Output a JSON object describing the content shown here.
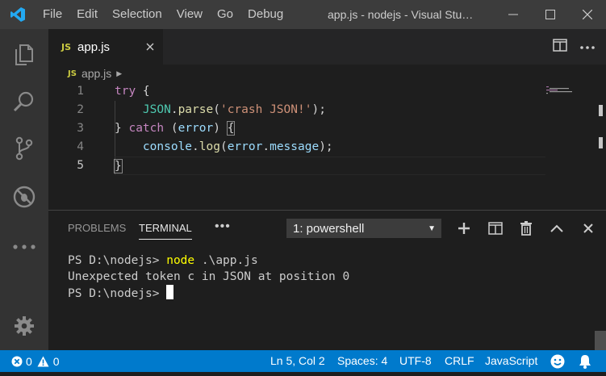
{
  "titlebar": {
    "menu": [
      "File",
      "Edit",
      "Selection",
      "View",
      "Go",
      "Debug"
    ],
    "window_title": "app.js - nodejs - Visual Stu…",
    "logo_icon": "vscode-logo-icon",
    "logo_color": "#23a9f2"
  },
  "activitybar": {
    "icons": [
      "explorer-icon",
      "search-icon",
      "source-control-icon",
      "debug-icon",
      "more-icon",
      "settings-gear-icon"
    ]
  },
  "editor": {
    "tab": {
      "label": "app.js",
      "badge": "JS"
    },
    "breadcrumb": {
      "badge": "JS",
      "file": "app.js"
    },
    "line_numbers": [
      "1",
      "2",
      "3",
      "4",
      "5"
    ],
    "active_line": 5,
    "code": {
      "l1": {
        "kw": "try",
        "rest": " {"
      },
      "l2": {
        "indent": "    ",
        "cls": "JSON",
        "dot": ".",
        "fn": "parse",
        "open": "(",
        "str": "'crash JSON!'",
        "close": ");"
      },
      "l3": {
        "open": "} ",
        "kw": "catch",
        "p1": " (",
        "var": "error",
        "p2": ") ",
        "brace": "{"
      },
      "l4": {
        "indent": "    ",
        "var1": "console",
        "dot1": ".",
        "fn": "log",
        "open": "(",
        "var2": "error",
        "dot2": ".",
        "prop": "message",
        "close": ");"
      },
      "l5": {
        "brace": "}"
      }
    }
  },
  "panel": {
    "tabs": [
      "PROBLEMS",
      "TERMINAL"
    ],
    "active_tab": "TERMINAL",
    "more": "•••",
    "terminal_select": "1: powershell",
    "terminal_lines": {
      "l1_prompt": "PS D:\\nodejs> ",
      "l1_cmd": "node",
      "l1_args": " .\\app.js",
      "l2": "Unexpected token c in JSON at position 0",
      "l3_prompt": "PS D:\\nodejs> "
    }
  },
  "statusbar": {
    "errors": "0",
    "warnings": "0",
    "position": "Ln 5, Col 2",
    "spaces": "Spaces: 4",
    "encoding": "UTF-8",
    "eol": "CRLF",
    "language": "JavaScript",
    "color": "#007acc"
  }
}
